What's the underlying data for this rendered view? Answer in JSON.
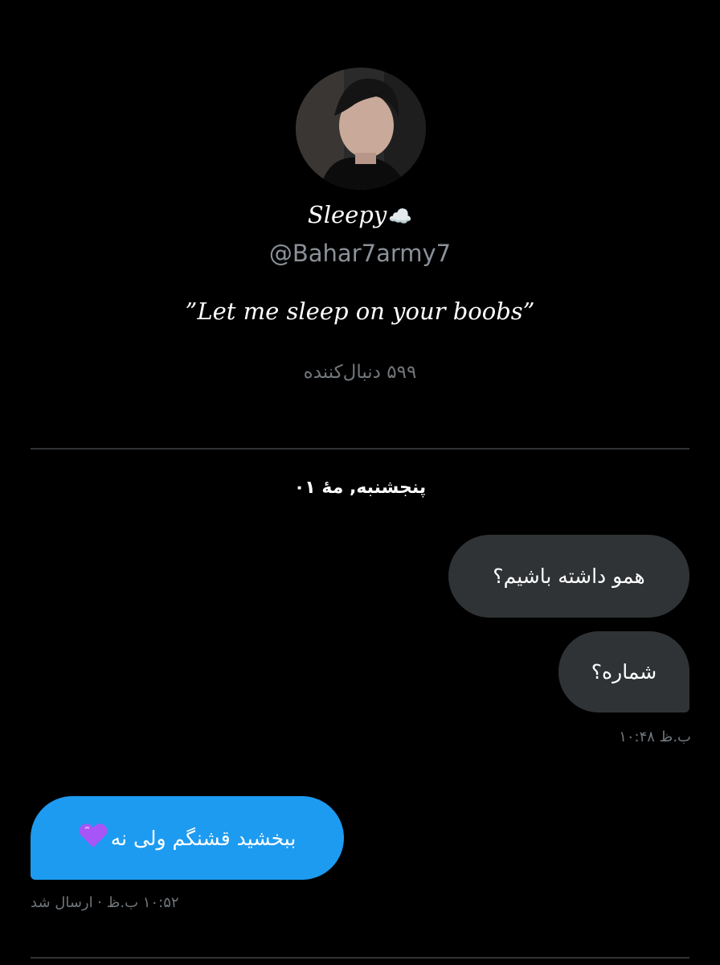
{
  "profile": {
    "display_name": "Sleepy",
    "display_name_emoji": "☁️",
    "handle": "@Bahar7army7",
    "bio": "”Let me sleep on your boobs”",
    "followers": "۵۹۹ دنبال‌کننده"
  },
  "conversation": {
    "date_separator": "پنجشنبه, مهٔ ۰۱",
    "messages": [
      {
        "direction": "received",
        "text": "همو داشته باشیم؟"
      },
      {
        "direction": "received",
        "text": "شماره؟"
      }
    ],
    "received_timestamp": "۱۰:۴۸ ب.ظ",
    "sent_message": {
      "text": "ببخشید قشنگم ولی نه",
      "emoji": "purple-heart"
    },
    "sent_status": "۱۰:۵۲ ب.ظ · ارسال شد"
  },
  "colors": {
    "background": "#000000",
    "received_bubble": "#2f3336",
    "sent_bubble": "#1d9bf0",
    "secondary_text": "#71767b"
  }
}
